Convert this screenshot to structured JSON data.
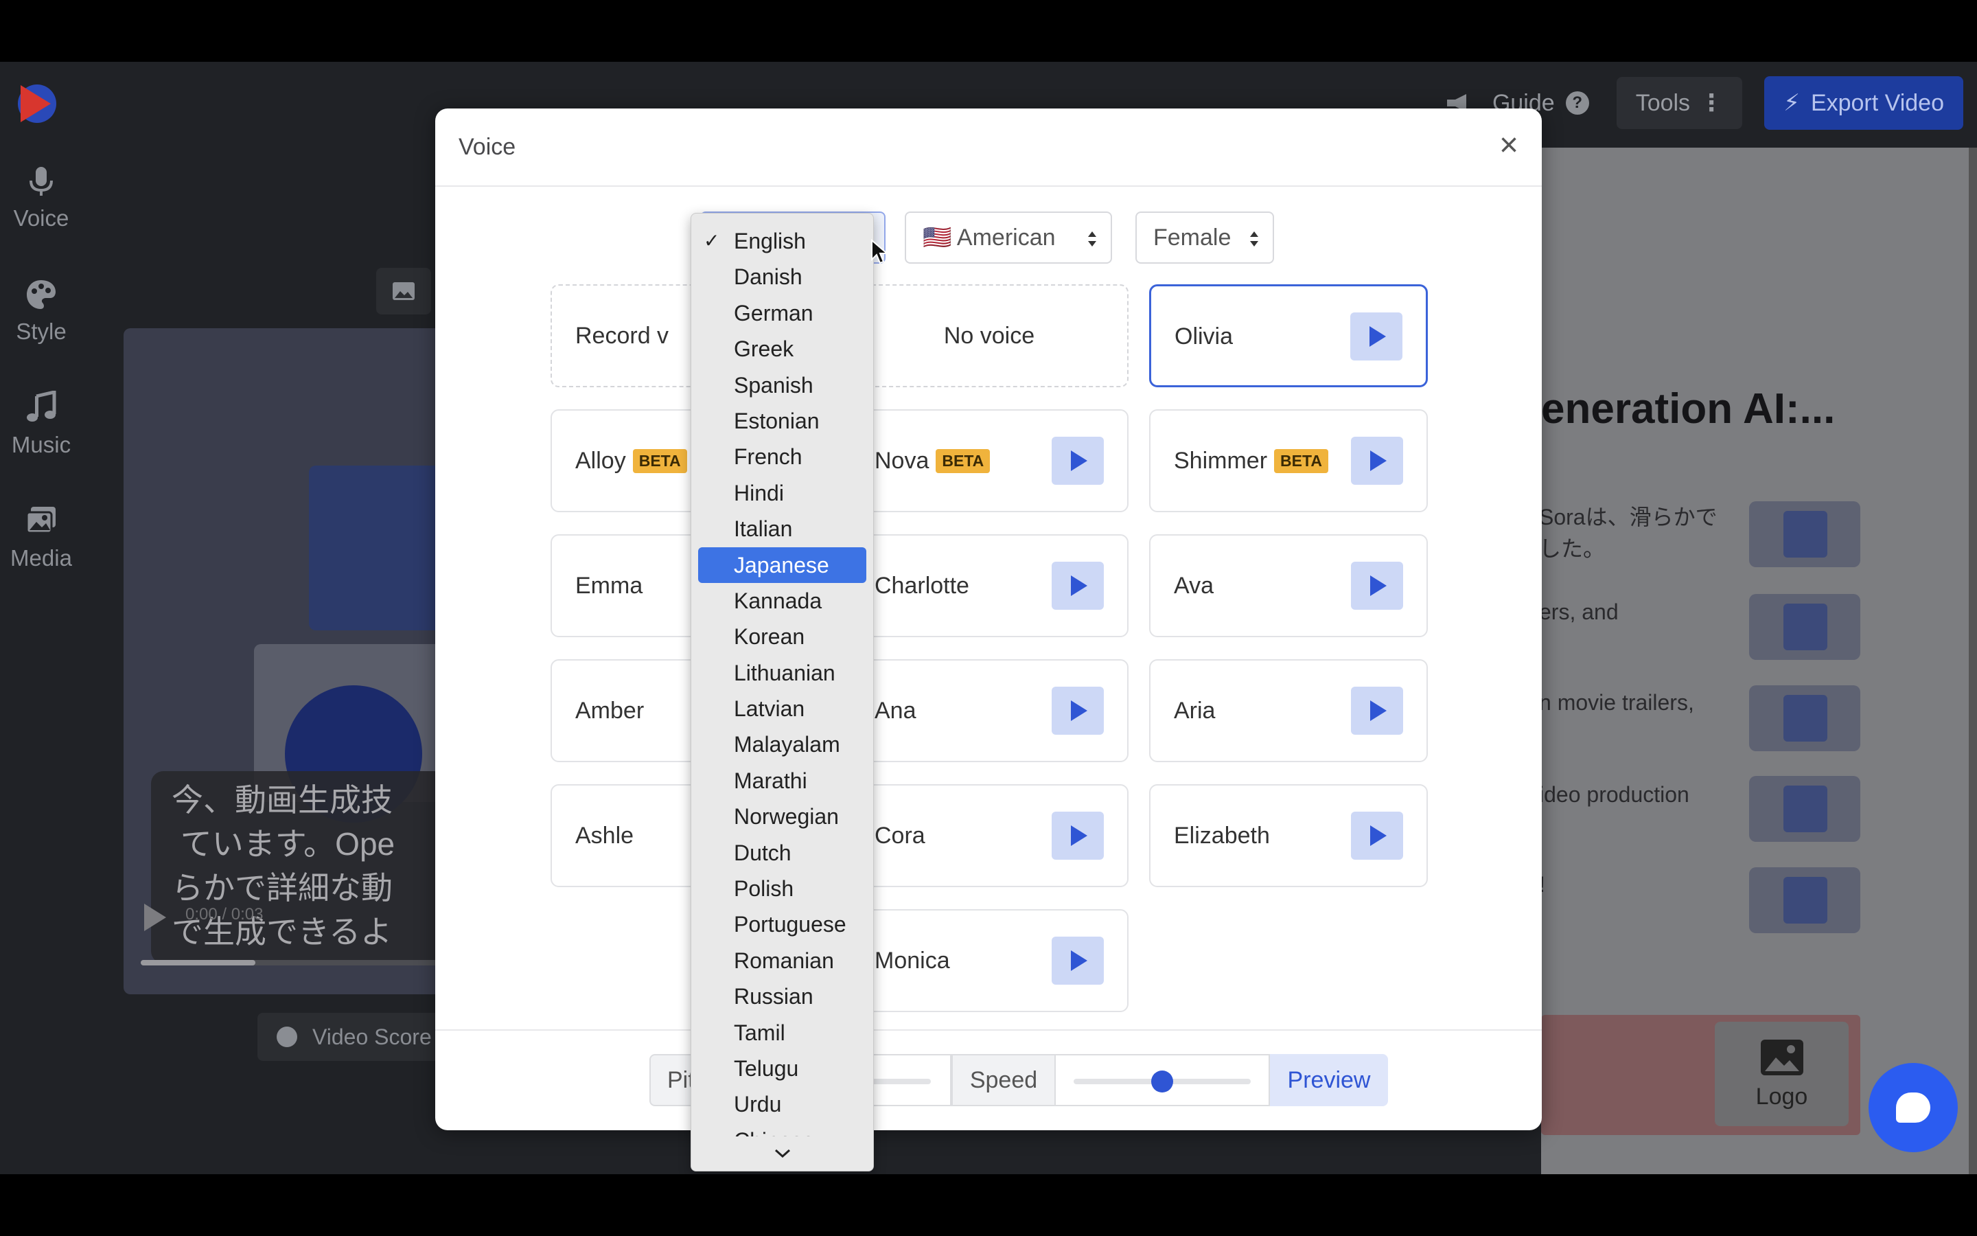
{
  "topbar": {
    "guide_label": "Guide",
    "tools_label": "Tools",
    "export_label": "Export Video"
  },
  "sidebar": {
    "items": [
      {
        "label": "Voice",
        "icon": "microphone-icon"
      },
      {
        "label": "Style",
        "icon": "palette-icon"
      },
      {
        "label": "Music",
        "icon": "music-note-icon"
      },
      {
        "label": "Media",
        "icon": "images-icon"
      }
    ]
  },
  "preview": {
    "subtitle": "今、動画生成技\n ています。Ope\nらかで詳細な動\nで生成できるよ",
    "timecode": "0:00 / 0:03",
    "progress_fraction": 0.38,
    "score_button_label": "Video Score"
  },
  "right_panel": {
    "heading": "eneration AI:...",
    "lines": [
      "Soraは、滑らかで\nした。",
      "ers, and",
      "n movie trailers,",
      "ideo production",
      "!"
    ],
    "logo_label": "Logo"
  },
  "modal": {
    "title": "Voice",
    "close_glyph": "×",
    "filters": {
      "accent_value": "🇺🇸 American",
      "gender_value": "Female"
    },
    "voices": [
      {
        "name": "Record v",
        "kind": "record"
      },
      {
        "name": "No voice",
        "kind": "none"
      },
      {
        "name": "Olivia",
        "selected": true
      },
      {
        "name": "Alloy",
        "beta": "BETA"
      },
      {
        "name": "Nova",
        "beta": "BETA"
      },
      {
        "name": "Shimmer",
        "beta": "BETA"
      },
      {
        "name": "Emma"
      },
      {
        "name": "Charlotte"
      },
      {
        "name": "Ava"
      },
      {
        "name": "Amber"
      },
      {
        "name": "Ana"
      },
      {
        "name": "Aria"
      },
      {
        "name": "Ashle"
      },
      {
        "name": "Cora"
      },
      {
        "name": "Elizabeth"
      },
      {
        "name": "Monica"
      }
    ],
    "footer": {
      "pitch_label": "Pit",
      "speed_label": "Speed",
      "speed_value_fraction": 0.5,
      "preview_label": "Preview"
    }
  },
  "language_dropdown": {
    "selected": "English",
    "highlighted": "Japanese",
    "check_glyph": "✓",
    "options": [
      "English",
      "Danish",
      "German",
      "Greek",
      "Spanish",
      "Estonian",
      "French",
      "Hindi",
      "Italian",
      "Japanese",
      "Kannada",
      "Korean",
      "Lithuanian",
      "Latvian",
      "Malayalam",
      "Marathi",
      "Norwegian",
      "Dutch",
      "Polish",
      "Portuguese",
      "Romanian",
      "Russian",
      "Tamil",
      "Telugu",
      "Urdu",
      "Chinese"
    ]
  },
  "colors": {
    "accent": "#2f55d4",
    "highlight": "#3d73e4",
    "beta_badge": "#f0b33c",
    "export_button": "#1d3c9e"
  }
}
